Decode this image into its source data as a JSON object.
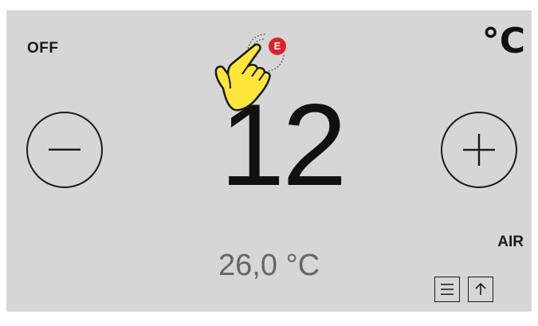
{
  "power_label": "OFF",
  "unit_label": "°C",
  "set_temperature": "12",
  "current_temperature": "26,0 °C",
  "mode_label": "AIR",
  "badge_letter": "E",
  "icons": {
    "minus": "minus-icon",
    "plus": "plus-icon",
    "menu": "menu-lines-icon",
    "up": "arrow-up-icon",
    "hand": "tap-hand-icon"
  },
  "colors": {
    "screen_bg": "#d6d6d6",
    "text_dark": "#111111",
    "text_gray": "#666666",
    "badge_red": "#e3202a",
    "hand_yellow": "#ffe63a"
  }
}
